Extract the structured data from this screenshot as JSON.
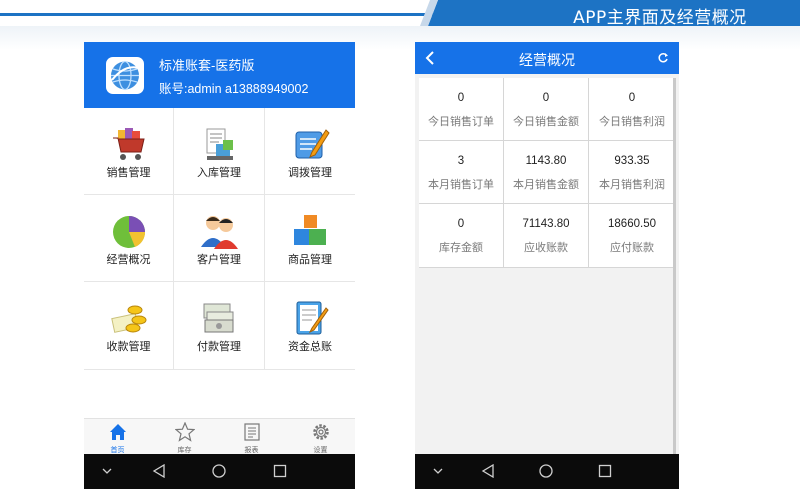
{
  "banner": {
    "title": "APP主界面及经营概况"
  },
  "left_phone": {
    "header": {
      "account_name": "标准账套-医药版",
      "account_id": "账号:admin a13888949002"
    },
    "modules": [
      {
        "label": "销售管理",
        "icon": "shopping-cart-icon"
      },
      {
        "label": "入库管理",
        "icon": "stock-in-icon"
      },
      {
        "label": "调拨管理",
        "icon": "transfer-icon"
      },
      {
        "label": "经营概况",
        "icon": "pie-chart-icon"
      },
      {
        "label": "客户管理",
        "icon": "customers-icon"
      },
      {
        "label": "商品管理",
        "icon": "products-icon"
      },
      {
        "label": "收款管理",
        "icon": "coins-icon"
      },
      {
        "label": "付款管理",
        "icon": "cash-icon"
      },
      {
        "label": "资金总账",
        "icon": "ledger-icon"
      }
    ],
    "tabs": [
      {
        "label": "首页",
        "icon": "home-icon"
      },
      {
        "label": "库存",
        "icon": "star-icon"
      },
      {
        "label": "报表",
        "icon": "report-icon"
      },
      {
        "label": "设置",
        "icon": "gear-icon"
      }
    ]
  },
  "right_phone": {
    "header": {
      "title": "经营概况"
    },
    "stats": [
      {
        "value": "0",
        "label": "今日销售订单"
      },
      {
        "value": "0",
        "label": "今日销售金额"
      },
      {
        "value": "0",
        "label": "今日销售利润"
      },
      {
        "value": "3",
        "label": "本月销售订单"
      },
      {
        "value": "1143.80",
        "label": "本月销售金额"
      },
      {
        "value": "933.35",
        "label": "本月销售利润"
      },
      {
        "value": "0",
        "label": "库存金额"
      },
      {
        "value": "71143.80",
        "label": "应收账款"
      },
      {
        "value": "18660.50",
        "label": "应付账款"
      }
    ]
  },
  "colors": {
    "primary": "#1672e8",
    "banner": "#1d73c4",
    "navbar": "#0b0b0b"
  }
}
